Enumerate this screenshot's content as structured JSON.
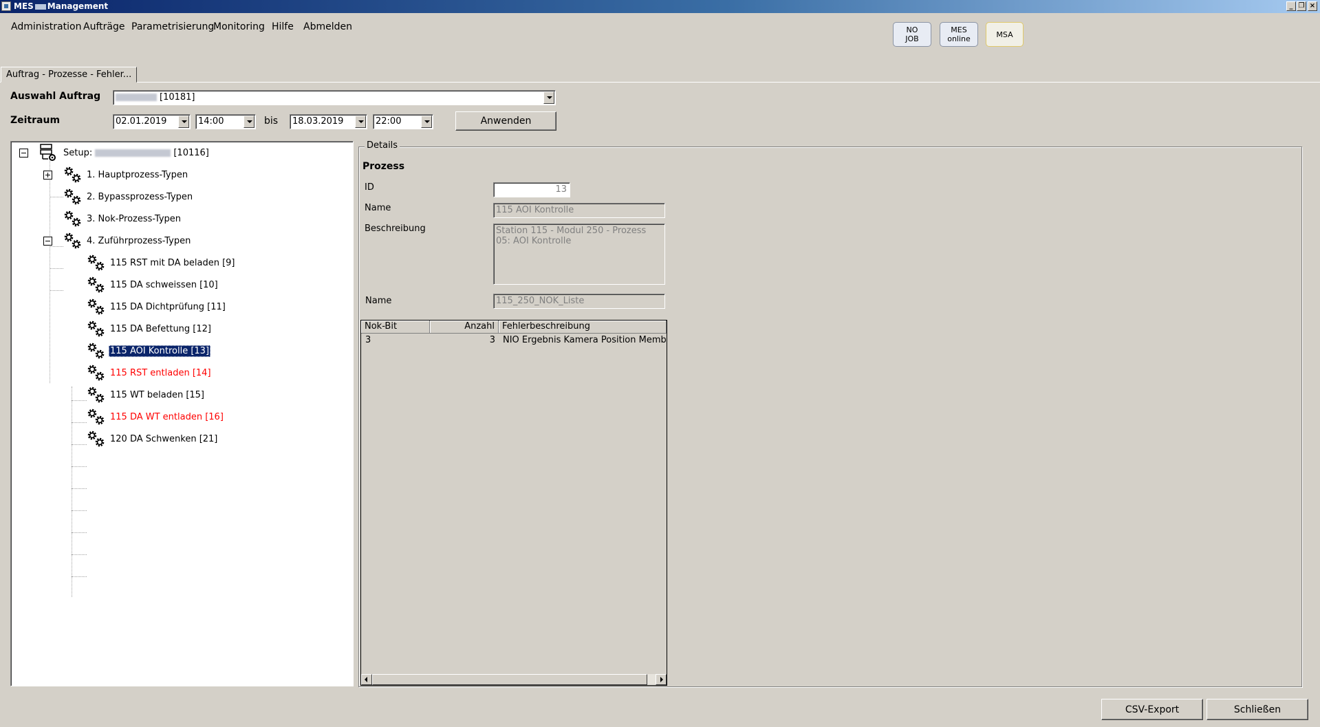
{
  "window": {
    "title_prefix": "MES",
    "title_suffix": "Management",
    "controls": [
      "_",
      "❐",
      "×"
    ]
  },
  "menu": [
    "Administration",
    "Aufträge",
    "Parametrisierung",
    "Monitoring",
    "Hilfe",
    "Abmelden"
  ],
  "status_buttons": {
    "no_job_1": "NO",
    "no_job_2": "JOB",
    "mes_online_1": "MES",
    "mes_online_2": "online",
    "msa": "MSA"
  },
  "tab": "Auftrag - Prozesse - Fehler...",
  "filters": {
    "auftrag_label": "Auswahl Auftrag",
    "auftrag_value": "[10181]",
    "zeitraum_label": "Zeitraum",
    "from_date": "02.01.2019",
    "from_time": "14:00",
    "bis_label": "bis",
    "to_date": "18.03.2019",
    "to_time": "22:00",
    "apply_button": "Anwenden"
  },
  "tree": {
    "root_prefix": "Setup:",
    "root_suffix": "[10116]",
    "groups": [
      "1. Hauptprozess-Typen",
      "2. Bypassprozess-Typen",
      "3. Nok-Prozess-Typen",
      "4. Zuführprozess-Typen"
    ],
    "children": [
      "115 RST mit DA beladen [9]",
      "115 DA schweissen [10]",
      "115 DA Dichtprüfung [11]",
      "115 DA Befettung [12]",
      "115 AOI Kontrolle [13]",
      "115 RST entladen [14]",
      "115 WT beladen [15]",
      "115 DA WT entladen [16]",
      "120 DA Schwenken [21]"
    ],
    "selected": "115 AOI Kontrolle [13]",
    "red_items": [
      "115 RST entladen [14]",
      "115 DA WT entladen [16]"
    ]
  },
  "details": {
    "group_label": "Details",
    "section_title": "Prozess",
    "id_label": "ID",
    "id_value": "13",
    "name_label": "Name",
    "name_value": "115 AOI Kontrolle",
    "beschreibung_label": "Beschreibung",
    "beschreibung_value": "Station 115 - Modul 250 - Prozess 05: AOI Kontrolle",
    "name2_label": "Name",
    "name2_value": "115_250_NOK_Liste"
  },
  "grid": {
    "columns": [
      "Nok-Bit",
      "Anzahl",
      "Fehlerbeschreibung"
    ],
    "rows": [
      {
        "nok_bit": "3",
        "anzahl": "3",
        "fehlerbeschreibung": "NIO Ergebnis Kamera Position Membran"
      }
    ]
  },
  "footer": {
    "csv_export": "CSV-Export",
    "close": "Schließen"
  },
  "colors": {
    "selection": "#0a246a",
    "error_text": "#ff0000",
    "window_bg": "#d4d0c8"
  }
}
